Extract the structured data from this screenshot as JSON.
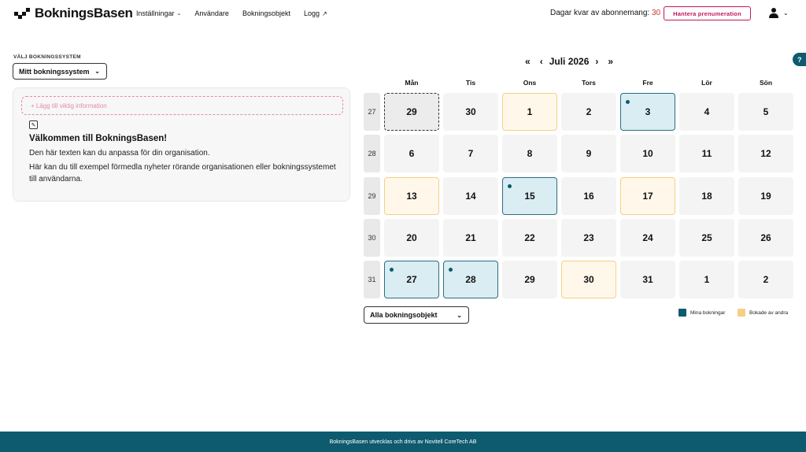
{
  "app": {
    "logo_text": "BokningsBasen"
  },
  "nav": {
    "settings": "Inställningar",
    "users": "Användare",
    "objects": "Bokningsobjekt",
    "log": "Logg"
  },
  "subscription": {
    "label": "Dagar kvar av abonnemang:",
    "days": "30",
    "manage_button": "Hantera prenumeration"
  },
  "left": {
    "system_label": "VÄLJ BOKNINGSSYSTEM",
    "system_selected": "Mitt bokningssystem",
    "add_info": "+ Lägg till viktig information",
    "welcome_title": "Välkommen till BokningsBasen!",
    "welcome_line1": "Den här texten kan du anpassa för din organisation.",
    "welcome_line2": "Här kan du till exempel förmedla nyheter rörande organisationen eller bokningssystemet till användarna."
  },
  "calendar": {
    "prev_year": "«",
    "prev_month": "‹",
    "title": "Juli 2026",
    "next_month": "›",
    "next_year": "»",
    "weekdays": [
      "Mån",
      "Tis",
      "Ons",
      "Tors",
      "Fre",
      "Lör",
      "Sön"
    ],
    "weeks": [
      {
        "num": "27",
        "days": [
          {
            "d": "29",
            "state": "today"
          },
          {
            "d": "30",
            "state": "other"
          },
          {
            "d": "1",
            "state": "others"
          },
          {
            "d": "2",
            "state": ""
          },
          {
            "d": "3",
            "state": "mine"
          },
          {
            "d": "4",
            "state": ""
          },
          {
            "d": "5",
            "state": ""
          }
        ]
      },
      {
        "num": "28",
        "days": [
          {
            "d": "6",
            "state": ""
          },
          {
            "d": "7",
            "state": ""
          },
          {
            "d": "8",
            "state": ""
          },
          {
            "d": "9",
            "state": ""
          },
          {
            "d": "10",
            "state": ""
          },
          {
            "d": "11",
            "state": ""
          },
          {
            "d": "12",
            "state": ""
          }
        ]
      },
      {
        "num": "29",
        "days": [
          {
            "d": "13",
            "state": "others"
          },
          {
            "d": "14",
            "state": ""
          },
          {
            "d": "15",
            "state": "mine"
          },
          {
            "d": "16",
            "state": ""
          },
          {
            "d": "17",
            "state": "others"
          },
          {
            "d": "18",
            "state": ""
          },
          {
            "d": "19",
            "state": ""
          }
        ]
      },
      {
        "num": "30",
        "days": [
          {
            "d": "20",
            "state": ""
          },
          {
            "d": "21",
            "state": ""
          },
          {
            "d": "22",
            "state": ""
          },
          {
            "d": "23",
            "state": ""
          },
          {
            "d": "24",
            "state": ""
          },
          {
            "d": "25",
            "state": ""
          },
          {
            "d": "26",
            "state": ""
          }
        ]
      },
      {
        "num": "31",
        "days": [
          {
            "d": "27",
            "state": "mine"
          },
          {
            "d": "28",
            "state": "mine"
          },
          {
            "d": "29",
            "state": ""
          },
          {
            "d": "30",
            "state": "others"
          },
          {
            "d": "31",
            "state": ""
          },
          {
            "d": "1",
            "state": "other"
          },
          {
            "d": "2",
            "state": "other"
          }
        ]
      }
    ],
    "object_select": "Alla bokningsobjekt",
    "legend_mine": "Mina bokningar",
    "legend_others": "Bokade av andra"
  },
  "colors": {
    "brand": "#0e5a6f",
    "mine": "#0e5a6f",
    "others": "#f6cf86",
    "accent": "#c2185b"
  },
  "help": {
    "label": "?"
  },
  "footer": {
    "text": "BokningsBasen utvecklas och drivs av Novitell CoreTech AB"
  }
}
